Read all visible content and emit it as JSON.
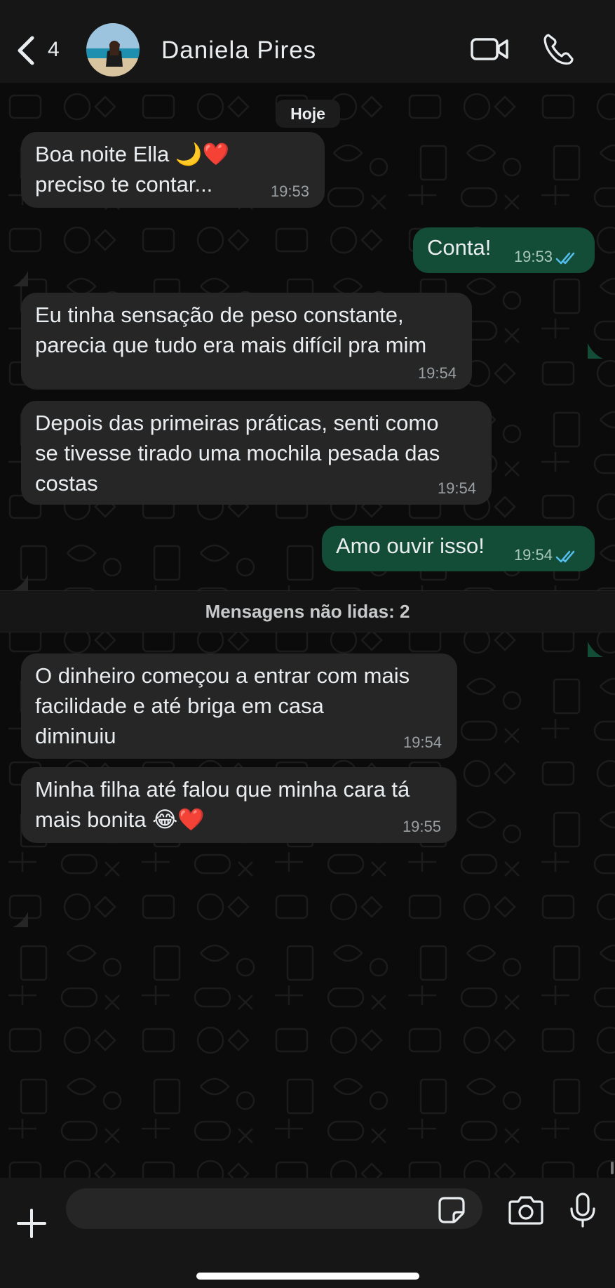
{
  "header": {
    "back_count": "4",
    "contact_name": "Daniela Pires"
  },
  "chat": {
    "date_label": "Hoje",
    "unread_label": "Mensagens não lidas: 2",
    "messages": [
      {
        "direction": "in",
        "text": "Boa noite Ella 🌙❤️\npreciso te contar...",
        "time": "19:53"
      },
      {
        "direction": "out",
        "text": "Conta!",
        "time": "19:53",
        "status": "read"
      },
      {
        "direction": "in",
        "text": "Eu tinha sensação de peso constante,\nparecia que tudo era mais difícil pra mim",
        "time": "19:54"
      },
      {
        "direction": "in",
        "text": "Depois das primeiras práticas, senti como\nse tivesse tirado uma mochila pesada das\ncostas",
        "time": "19:54"
      },
      {
        "direction": "out",
        "text": "Amo ouvir isso!",
        "time": "19:54",
        "status": "read"
      },
      {
        "direction": "in",
        "text": "O dinheiro começou a entrar com mais\nfacilidade e até briga em casa\ndiminuiu",
        "time": "19:54"
      },
      {
        "direction": "in",
        "text": "Minha filha até falou que minha cara tá\nmais bonita 😂❤️",
        "time": "19:55"
      }
    ]
  },
  "input": {
    "placeholder": "",
    "value": ""
  },
  "colors": {
    "incoming_bubble": "#262626",
    "outgoing_bubble": "#144d37",
    "read_ticks": "#53bdeb",
    "background": "#0b0b0b"
  },
  "icons": {
    "back": "chevron-left-icon",
    "video": "video-camera-icon",
    "phone": "phone-icon",
    "plus": "plus-icon",
    "sticker": "sticker-icon",
    "camera": "camera-icon",
    "mic": "microphone-icon",
    "read": "double-check-icon"
  }
}
